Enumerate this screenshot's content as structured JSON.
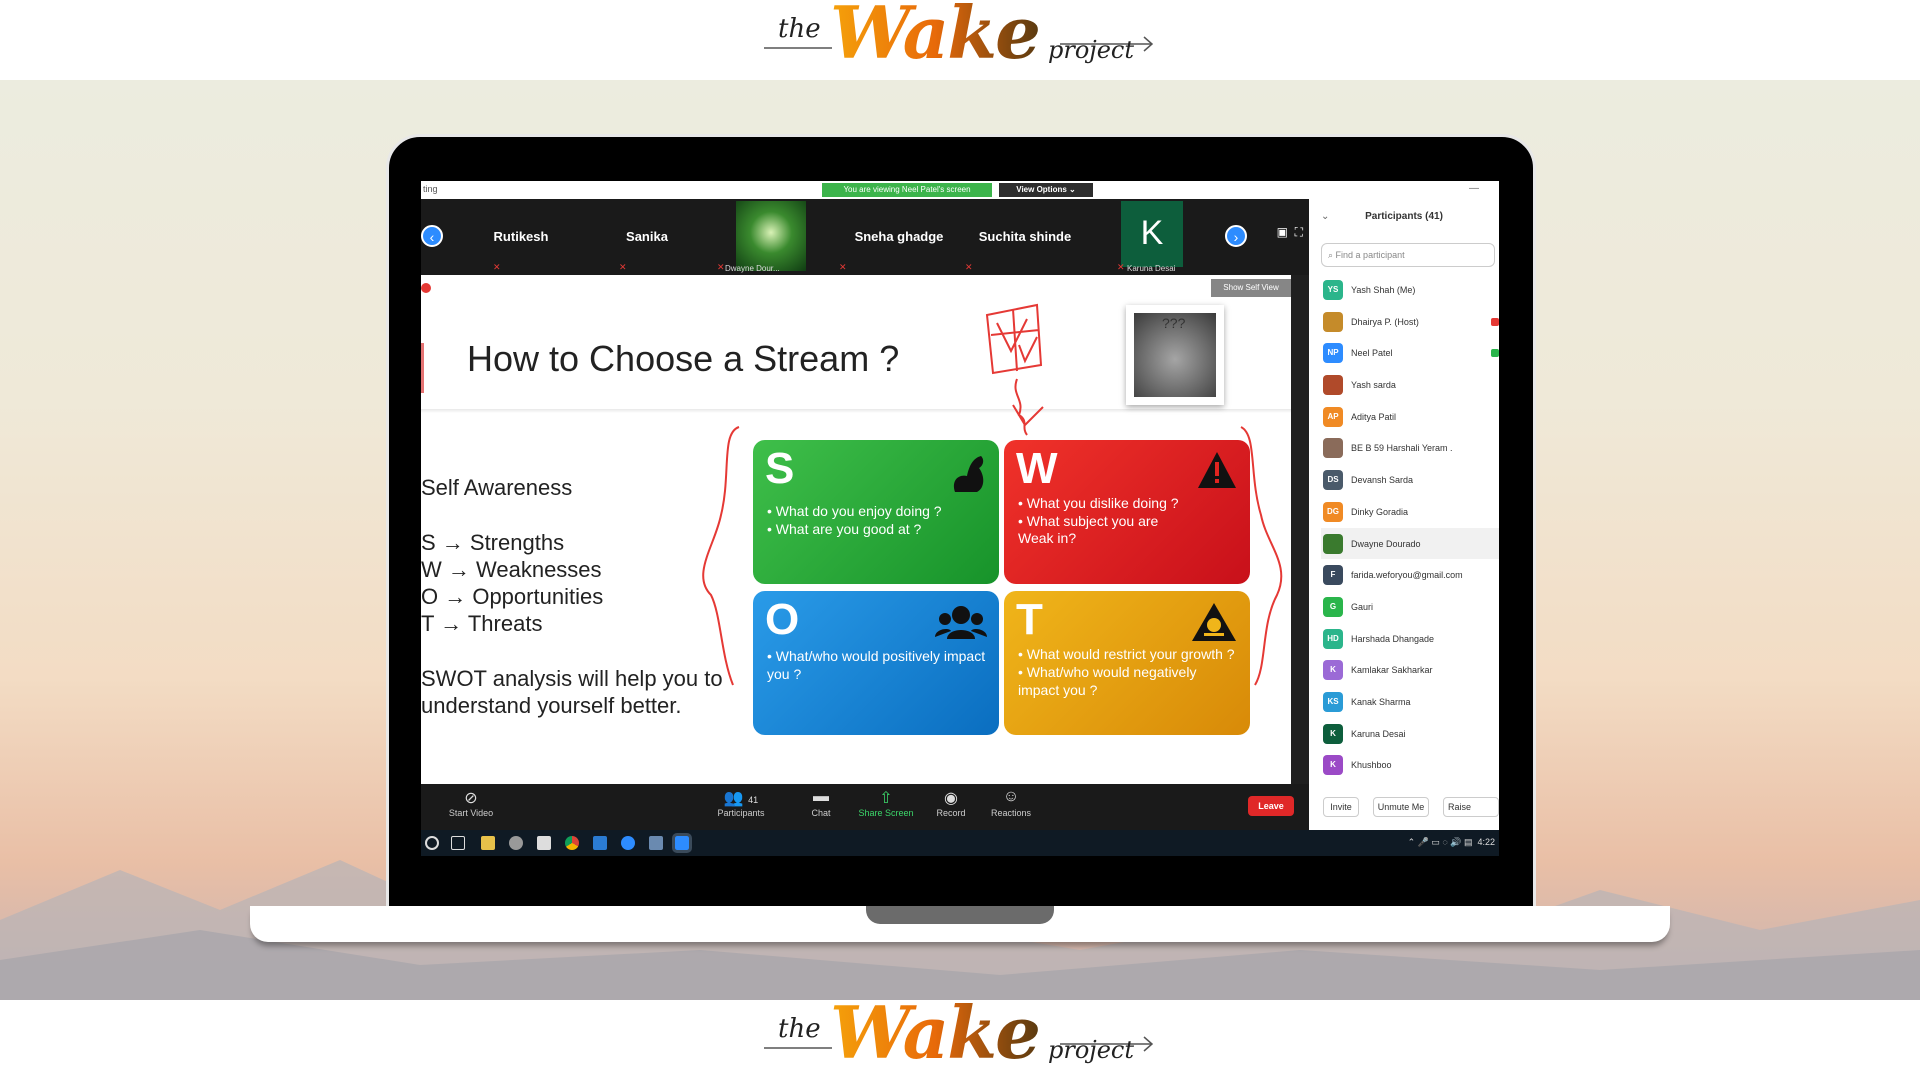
{
  "brand": {
    "the": "the",
    "wake": "Wake",
    "project": "project"
  },
  "zoom": {
    "app_title": "ting",
    "share_banner": "You are viewing Neel Patel's screen",
    "view_options": "View Options ⌄",
    "gallery": [
      {
        "name": "Rutikesh"
      },
      {
        "name": "Sanika"
      },
      {
        "name": "Dwayne Dour...",
        "type": "video"
      },
      {
        "name": "Sneha ghadge"
      },
      {
        "name": "Suchita shinde"
      },
      {
        "name": "Karuna Desai",
        "initial": "K"
      }
    ],
    "show_self_view": "Show Self View",
    "controls": {
      "start_video": "Start Video",
      "participants_label": "Participants",
      "participants_count": "41",
      "chat": "Chat",
      "share_screen": "Share Screen",
      "record": "Record",
      "reactions": "Reactions",
      "leave": "Leave"
    },
    "tray_time": "4:22"
  },
  "slide": {
    "title": "How to Choose a Stream ?",
    "self_awareness": "Self Awareness",
    "items": [
      "S → Strengths",
      "W → Weaknesses",
      "O → Opportunities",
      "T → Threats"
    ],
    "summary_line1": "SWOT analysis will help you to",
    "summary_line2": "understand yourself better.",
    "cat_text": "???",
    "swot": {
      "s": {
        "letter": "S",
        "lines": [
          "What do you enjoy doing ?",
          "What are you good at ?"
        ],
        "color": "#2eaa3c"
      },
      "w": {
        "letter": "W",
        "lines": [
          "What you dislike doing ?",
          "What subject you are"
        ],
        "extra": "Weak in?",
        "color": "#e0241f"
      },
      "o": {
        "letter": "O",
        "lines": [
          "What/who would positively impact you ?"
        ],
        "color": "#1f86d6"
      },
      "t": {
        "letter": "T",
        "lines": [
          "What would restrict your growth ?",
          "What/who would negatively impact you ?"
        ],
        "color": "#e8a412"
      }
    }
  },
  "participants": {
    "title": "Participants (41)",
    "search_placeholder": "Find a participant",
    "list": [
      {
        "initials": "YS",
        "name": "Yash Shah (Me)",
        "color": "#2bb58b"
      },
      {
        "initials": "",
        "name": "Dhairya P. (Host)",
        "color": "#c58b2a"
      },
      {
        "initials": "NP",
        "name": "Neel Patel",
        "color": "#2d8cff"
      },
      {
        "initials": "",
        "name": "Yash sarda",
        "color": "#b04a2a"
      },
      {
        "initials": "AP",
        "name": "Aditya Patil",
        "color": "#f08a24"
      },
      {
        "initials": "",
        "name": "BE B 59 Harshali Yeram .",
        "color": "#8a6b5a"
      },
      {
        "initials": "DS",
        "name": "Devansh Sarda",
        "color": "#4a5a6a"
      },
      {
        "initials": "DG",
        "name": "Dinky Goradia",
        "color": "#f08a24"
      },
      {
        "initials": "",
        "name": "Dwayne Dourado",
        "color": "#3a7a2e"
      },
      {
        "initials": "F",
        "name": "farida.weforyou@gmail.com",
        "color": "#3a4a5e"
      },
      {
        "initials": "G",
        "name": "Gauri",
        "color": "#2ab54b"
      },
      {
        "initials": "HD",
        "name": "Harshada Dhangade",
        "color": "#2bb58b"
      },
      {
        "initials": "K",
        "name": "Kamlakar Sakharkar",
        "color": "#9b6ad6"
      },
      {
        "initials": "KS",
        "name": "Kanak Sharma",
        "color": "#2a9bd6"
      },
      {
        "initials": "K",
        "name": "Karuna Desai",
        "color": "#0d5e3c"
      },
      {
        "initials": "K",
        "name": "Khushboo",
        "color": "#9b4ac6"
      }
    ],
    "invite": "Invite",
    "unmute": "Unmute Me",
    "raise": "Raise"
  }
}
